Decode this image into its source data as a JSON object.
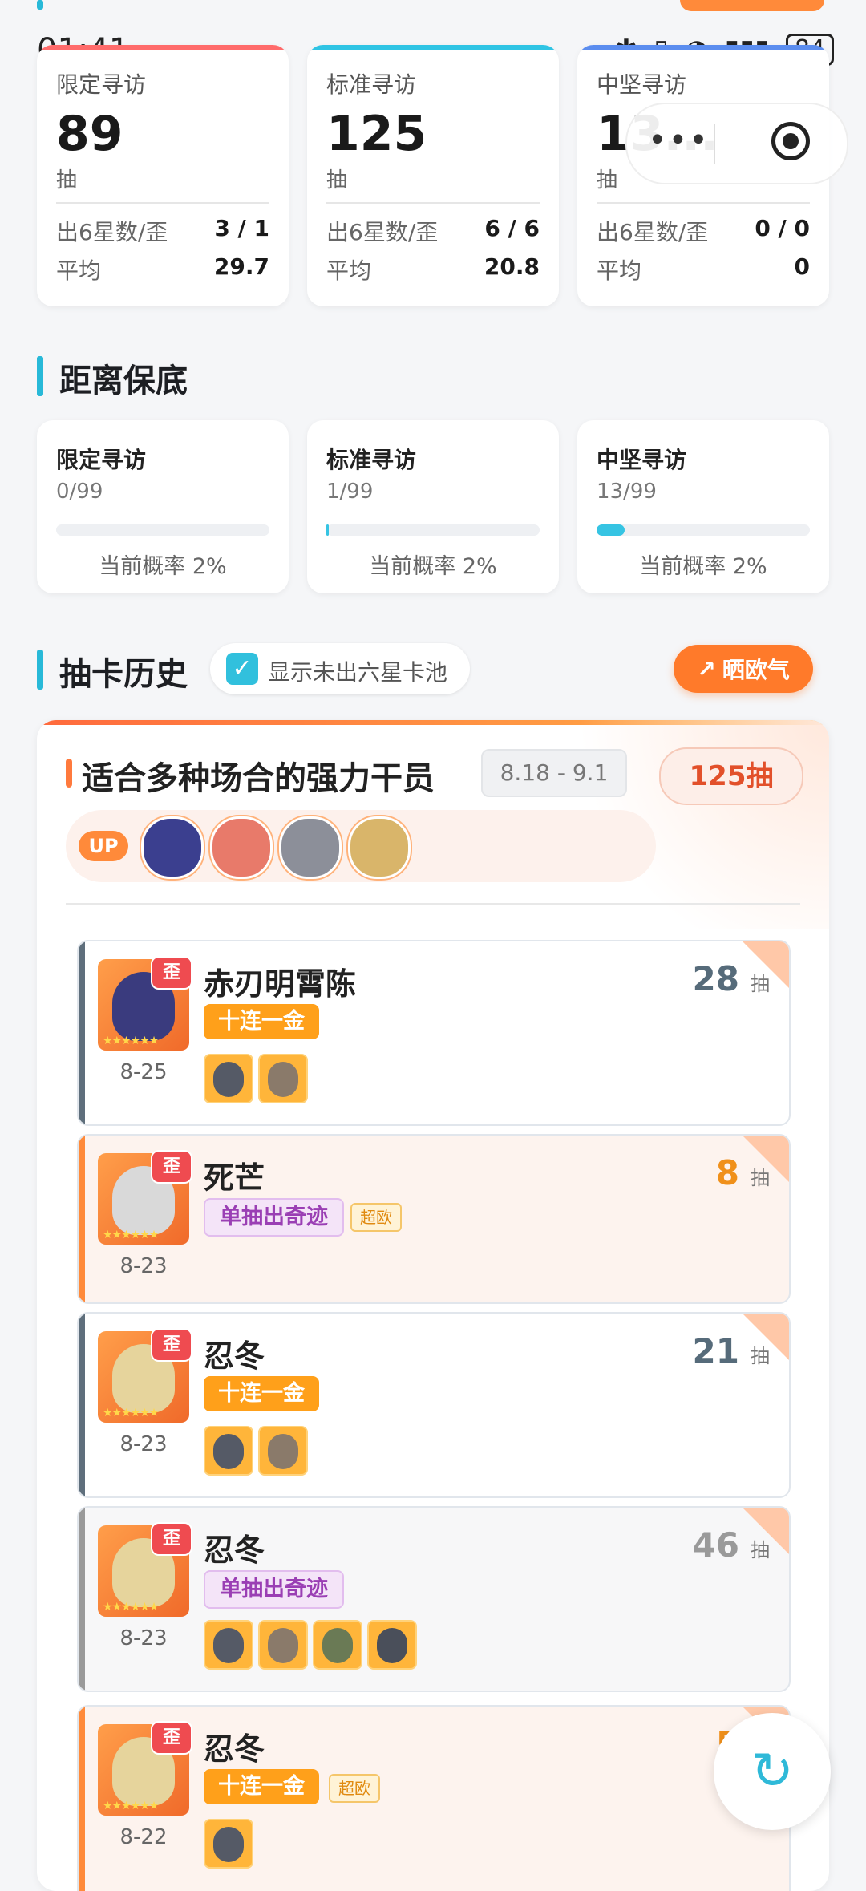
{
  "status": {
    "time": "01:41",
    "battery": "84"
  },
  "stats": {
    "cards": [
      {
        "name": "限定寻访",
        "total": "89",
        "unit": "抽",
        "six_label": "出6星数/歪",
        "six_value": "3 / 1",
        "avg_label": "平均",
        "avg_value": "29.7",
        "accent": "#ff6b6b"
      },
      {
        "name": "标准寻访",
        "total": "125",
        "unit": "抽",
        "six_label": "出6星数/歪",
        "six_value": "6 / 6",
        "avg_label": "平均",
        "avg_value": "20.8",
        "accent": "#2fc4e4"
      },
      {
        "name": "中坚寻访",
        "total": "13...",
        "unit": "抽",
        "six_label": "出6星数/歪",
        "six_value": "0 / 0",
        "avg_label": "平均",
        "avg_value": "0",
        "accent": "#5b8def"
      }
    ]
  },
  "pity": {
    "title": "距离保底",
    "cards": [
      {
        "name": "限定寻访",
        "count": "0/99",
        "progress": 0.0,
        "prob": "当前概率 2%"
      },
      {
        "name": "标准寻访",
        "count": "1/99",
        "progress": 0.0101,
        "prob": "当前概率 2%"
      },
      {
        "name": "中坚寻访",
        "count": "13/99",
        "progress": 0.1313,
        "prob": "当前概率 2%"
      }
    ]
  },
  "history": {
    "title": "抽卡历史",
    "toggle_label": "显示未出六星卡池",
    "share_label": "晒欧气",
    "pool": {
      "title": "适合多种场合的强力干员",
      "date": "8.18 - 9.1",
      "total": "125抽",
      "up_label": "UP"
    },
    "records": [
      {
        "name": "赤刃明霄陈",
        "date": "8-25",
        "badge": "歪",
        "stars": "★★★★★★",
        "tag": "十连一金",
        "tag_style": "gold",
        "extra_tag": "",
        "pulls": "28",
        "pull_unit": "抽",
        "pull_color": "#566b7a",
        "bar_color": "#5f6f7c",
        "bg": "#ffffff",
        "minis": 2
      },
      {
        "name": "死芒",
        "date": "8-23",
        "badge": "歪",
        "stars": "★★★★★★",
        "tag": "单抽出奇迹",
        "tag_style": "purple",
        "extra_tag": "超欧",
        "pulls": "8",
        "pull_unit": "抽",
        "pull_color": "#f0901a",
        "bar_color": "#ff8a3a",
        "bg": "#fdf3ee",
        "minis": 0
      },
      {
        "name": "忍冬",
        "date": "8-23",
        "badge": "歪",
        "stars": "★★★★★★",
        "tag": "十连一金",
        "tag_style": "gold",
        "extra_tag": "",
        "pulls": "21",
        "pull_unit": "抽",
        "pull_color": "#566b7a",
        "bar_color": "#5f6f7c",
        "bg": "#ffffff",
        "minis": 2
      },
      {
        "name": "忍冬",
        "date": "8-23",
        "badge": "歪",
        "stars": "★★★★★★",
        "tag": "单抽出奇迹",
        "tag_style": "purple",
        "extra_tag": "",
        "pulls": "46",
        "pull_unit": "抽",
        "pull_color": "#9a9a9a",
        "bar_color": "#9a9a9a",
        "bg": "#f7f7f8",
        "minis": 4
      },
      {
        "name": "忍冬",
        "date": "8-22",
        "badge": "歪",
        "stars": "★★★★★★",
        "tag": "十连一金",
        "tag_style": "gold",
        "extra_tag": "超欧",
        "pulls": "5",
        "pull_unit": "抽",
        "pull_color": "#f0901a",
        "bar_color": "#ff8a3a",
        "bg": "#fdf3ee",
        "minis": 1
      }
    ]
  },
  "icons": {
    "refresh": "refresh-icon",
    "share": "share-icon",
    "record": "record-icon"
  }
}
